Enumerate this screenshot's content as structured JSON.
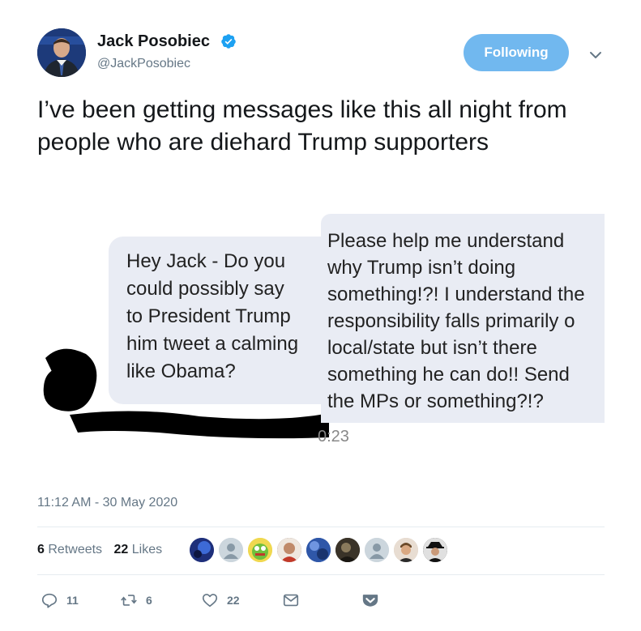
{
  "author": {
    "name": "Jack Posobiec",
    "handle": "@JackPosobiec",
    "verified": true,
    "avatar_icon": "profile-photo"
  },
  "follow_button": {
    "label": "Following"
  },
  "tweet": {
    "text": "I’ve been getting messages like this all night from people who are diehard Trump supporters"
  },
  "media": {
    "message1_lines": [
      "Hey Jack - Do you",
      "could possibly say",
      "to President Trump",
      "him tweet a calming",
      "like Obama?"
    ],
    "message2_lines": [
      "Please help me understand",
      "why Trump isn’t doing",
      "something!?! I understand the",
      "responsibility falls primarily o",
      "local/state but isn’t there",
      "something he can do!! Send",
      "the MPs or something?!?"
    ],
    "message_time": "0:23"
  },
  "timestamp": "11:12 AM - 30 May 2020",
  "stats": {
    "retweets_count": "6",
    "retweets_label": "Retweets",
    "likes_count": "22",
    "likes_label": "Likes"
  },
  "likers_count": 9,
  "actions": {
    "reply_count": "11",
    "retweet_count": "6",
    "like_count": "22"
  },
  "colors": {
    "accent": "#1da1f2",
    "follow_bg": "#71b8ef",
    "bubble_bg": "#e9ecf4",
    "muted": "#657786"
  }
}
